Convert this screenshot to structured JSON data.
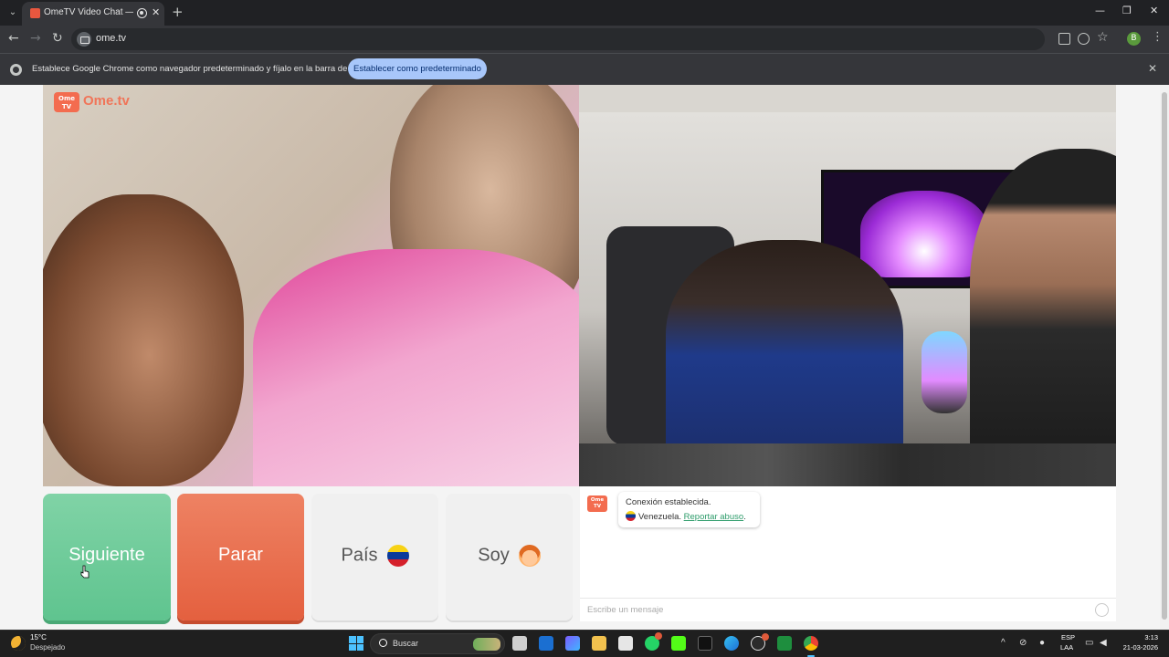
{
  "browser": {
    "tab_title": "OmeTV Video Chat — Ome",
    "url": "ome.tv",
    "profile_initial": "B",
    "infobar_text": "Establece Google Chrome como navegador predeterminado y fíjalo en la barra de tareas",
    "infobar_button": "Establecer como predeterminado"
  },
  "page": {
    "logo_box": "Ome TV",
    "logo_text": "Ome.tv",
    "buttons": {
      "next": "Siguiente",
      "stop": "Parar",
      "country": "País",
      "gender": "Soy"
    },
    "chat": {
      "logo_box": "Ome TV",
      "status_line": "Conexión establecida.",
      "country": "Venezuela.",
      "report_link": "Reportar abuso",
      "report_suffix": ".",
      "input_placeholder": "Escribe un mensaje"
    },
    "colors": {
      "next": "#5fc48f",
      "stop": "#e4603f",
      "brand": "#f36c4f"
    }
  },
  "taskbar": {
    "temperature": "15°C",
    "weather": "Despejado",
    "search_placeholder": "Buscar",
    "lang_line1": "ESP",
    "lang_line2": "LAA",
    "time": "3:13",
    "date": "21-03-2026",
    "apps": [
      "file-explorer",
      "outlook",
      "teams",
      "folder",
      "store",
      "whatsapp",
      "kick",
      "tiktok",
      "edge",
      "chatgpt",
      "sheets",
      "chrome"
    ]
  }
}
